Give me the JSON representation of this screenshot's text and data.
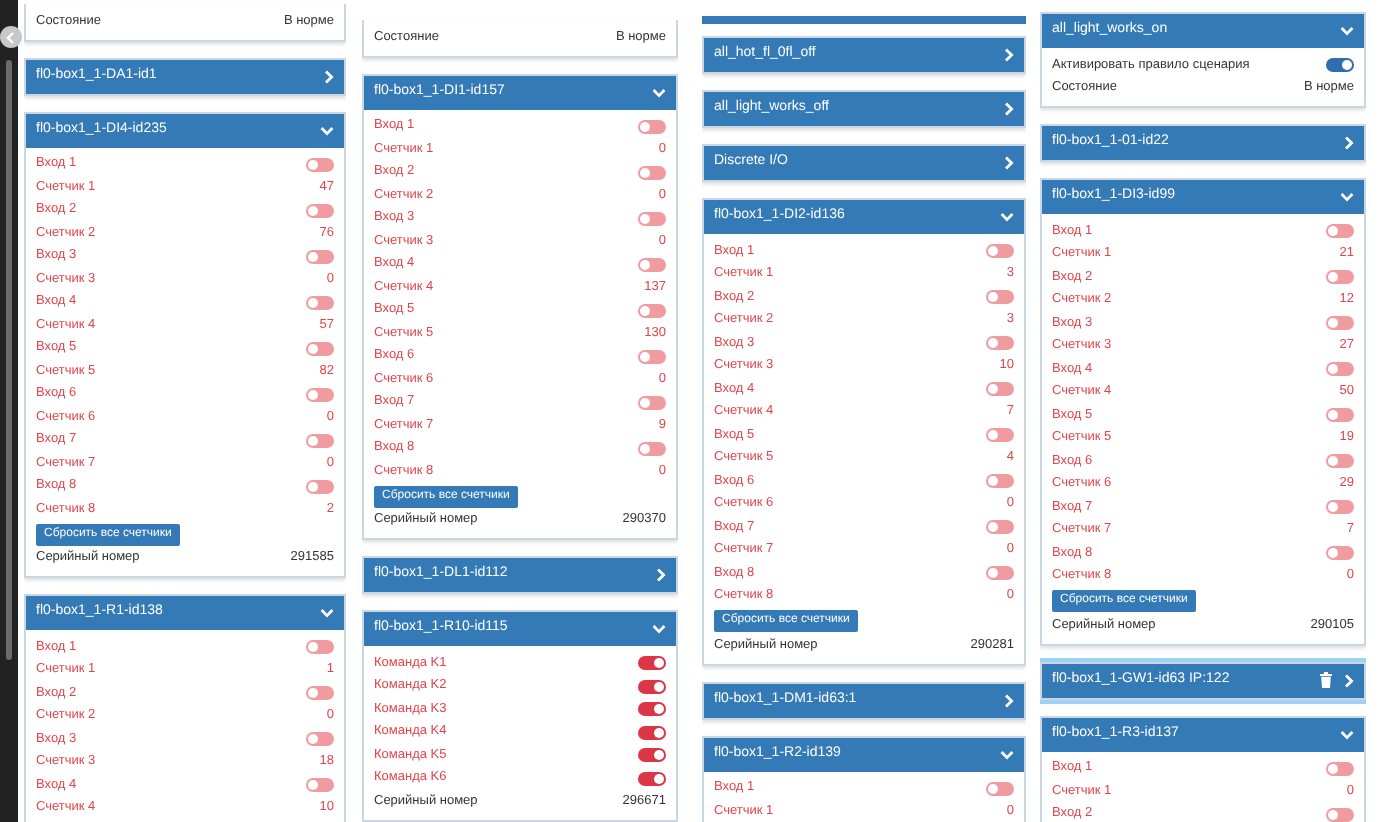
{
  "columns": [
    {
      "items": [
        {
          "kind": "card",
          "rows": [
            {
              "kind": "value",
              "label": "Состояние",
              "value": "В норме",
              "alert": false
            }
          ]
        },
        {
          "kind": "card",
          "title": "fl0-box1_1-DA1-id1",
          "expanded": false,
          "selected": false,
          "deletable": false
        },
        {
          "kind": "card",
          "title": "fl0-box1_1-DI4-id235",
          "expanded": true,
          "selected": false,
          "deletable": false,
          "rows": [
            {
              "kind": "toggle",
              "label": "Вход 1",
              "on": false,
              "alert": true
            },
            {
              "kind": "value",
              "label": "Счетчик 1",
              "value": "47",
              "alert": true
            },
            {
              "kind": "toggle",
              "label": "Вход 2",
              "on": false,
              "alert": true
            },
            {
              "kind": "value",
              "label": "Счетчик 2",
              "value": "76",
              "alert": true
            },
            {
              "kind": "toggle",
              "label": "Вход 3",
              "on": false,
              "alert": true
            },
            {
              "kind": "value",
              "label": "Счетчик 3",
              "value": "0",
              "alert": true
            },
            {
              "kind": "toggle",
              "label": "Вход 4",
              "on": false,
              "alert": true
            },
            {
              "kind": "value",
              "label": "Счетчик 4",
              "value": "57",
              "alert": true
            },
            {
              "kind": "toggle",
              "label": "Вход 5",
              "on": false,
              "alert": true
            },
            {
              "kind": "value",
              "label": "Счетчик 5",
              "value": "82",
              "alert": true
            },
            {
              "kind": "toggle",
              "label": "Вход 6",
              "on": false,
              "alert": true
            },
            {
              "kind": "value",
              "label": "Счетчик 6",
              "value": "0",
              "alert": true
            },
            {
              "kind": "toggle",
              "label": "Вход 7",
              "on": false,
              "alert": true
            },
            {
              "kind": "value",
              "label": "Счетчик 7",
              "value": "0",
              "alert": true
            },
            {
              "kind": "toggle",
              "label": "Вход 8",
              "on": false,
              "alert": true
            },
            {
              "kind": "value",
              "label": "Счетчик 8",
              "value": "2",
              "alert": true
            },
            {
              "kind": "button",
              "label": "Сбросить все счетчики"
            },
            {
              "kind": "value",
              "label": "Серийный номер",
              "value": "291585",
              "alert": false
            }
          ]
        },
        {
          "kind": "card",
          "title": "fl0-box1_1-R1-id138",
          "expanded": true,
          "selected": false,
          "deletable": false,
          "rows": [
            {
              "kind": "toggle",
              "label": "Вход 1",
              "on": false,
              "alert": true
            },
            {
              "kind": "value",
              "label": "Счетчик 1",
              "value": "1",
              "alert": true
            },
            {
              "kind": "toggle",
              "label": "Вход 2",
              "on": false,
              "alert": true
            },
            {
              "kind": "value",
              "label": "Счетчик 2",
              "value": "0",
              "alert": true
            },
            {
              "kind": "toggle",
              "label": "Вход 3",
              "on": false,
              "alert": true
            },
            {
              "kind": "value",
              "label": "Счетчик 3",
              "value": "18",
              "alert": true
            },
            {
              "kind": "toggle",
              "label": "Вход 4",
              "on": false,
              "alert": true
            },
            {
              "kind": "value",
              "label": "Счетчик 4",
              "value": "10",
              "alert": true
            }
          ]
        }
      ]
    },
    {
      "items": [
        {
          "kind": "card",
          "rows": [
            {
              "kind": "value",
              "label": "Состояние",
              "value": "В норме",
              "alert": false
            }
          ]
        },
        {
          "kind": "card",
          "title": "fl0-box1_1-DI1-id157",
          "expanded": true,
          "selected": false,
          "deletable": false,
          "rows": [
            {
              "kind": "toggle",
              "label": "Вход 1",
              "on": false,
              "alert": true
            },
            {
              "kind": "value",
              "label": "Счетчик 1",
              "value": "0",
              "alert": true
            },
            {
              "kind": "toggle",
              "label": "Вход 2",
              "on": false,
              "alert": true
            },
            {
              "kind": "value",
              "label": "Счетчик 2",
              "value": "0",
              "alert": true
            },
            {
              "kind": "toggle",
              "label": "Вход 3",
              "on": false,
              "alert": true
            },
            {
              "kind": "value",
              "label": "Счетчик 3",
              "value": "0",
              "alert": true
            },
            {
              "kind": "toggle",
              "label": "Вход 4",
              "on": false,
              "alert": true
            },
            {
              "kind": "value",
              "label": "Счетчик 4",
              "value": "137",
              "alert": true
            },
            {
              "kind": "toggle",
              "label": "Вход 5",
              "on": false,
              "alert": true
            },
            {
              "kind": "value",
              "label": "Счетчик 5",
              "value": "130",
              "alert": true
            },
            {
              "kind": "toggle",
              "label": "Вход 6",
              "on": false,
              "alert": true
            },
            {
              "kind": "value",
              "label": "Счетчик 6",
              "value": "0",
              "alert": true
            },
            {
              "kind": "toggle",
              "label": "Вход 7",
              "on": false,
              "alert": true
            },
            {
              "kind": "value",
              "label": "Счетчик 7",
              "value": "9",
              "alert": true
            },
            {
              "kind": "toggle",
              "label": "Вход 8",
              "on": false,
              "alert": true
            },
            {
              "kind": "value",
              "label": "Счетчик 8",
              "value": "0",
              "alert": true
            },
            {
              "kind": "button",
              "label": "Сбросить все счетчики"
            },
            {
              "kind": "value",
              "label": "Серийный номер",
              "value": "290370",
              "alert": false
            }
          ]
        },
        {
          "kind": "card",
          "title": "fl0-box1_1-DL1-id112",
          "expanded": false,
          "selected": false,
          "deletable": false
        },
        {
          "kind": "card",
          "title": "fl0-box1_1-R10-id115",
          "expanded": true,
          "selected": false,
          "deletable": false,
          "rows": [
            {
              "kind": "toggle",
              "label": "Команда K1",
              "on": true,
              "alert": true
            },
            {
              "kind": "toggle",
              "label": "Команда K2",
              "on": true,
              "alert": true
            },
            {
              "kind": "toggle",
              "label": "Команда K3",
              "on": true,
              "alert": true
            },
            {
              "kind": "toggle",
              "label": "Команда K4",
              "on": true,
              "alert": true
            },
            {
              "kind": "toggle",
              "label": "Команда K5",
              "on": true,
              "alert": true
            },
            {
              "kind": "toggle",
              "label": "Команда K6",
              "on": true,
              "alert": true
            },
            {
              "kind": "value",
              "label": "Серийный номер",
              "value": "296671",
              "alert": false
            }
          ]
        }
      ]
    },
    {
      "items": [
        {
          "kind": "header_fragment"
        },
        {
          "kind": "card",
          "title": "all_hot_fl_0fl_off",
          "expanded": false,
          "selected": false,
          "deletable": false
        },
        {
          "kind": "card",
          "title": "all_light_works_off",
          "expanded": false,
          "selected": false,
          "deletable": false
        },
        {
          "kind": "card",
          "title": "Discrete I/O",
          "expanded": false,
          "selected": false,
          "deletable": false
        },
        {
          "kind": "card",
          "title": "fl0-box1_1-DI2-id136",
          "expanded": true,
          "selected": false,
          "deletable": false,
          "rows": [
            {
              "kind": "toggle",
              "label": "Вход 1",
              "on": false,
              "alert": true
            },
            {
              "kind": "value",
              "label": "Счетчик 1",
              "value": "3",
              "alert": true
            },
            {
              "kind": "toggle",
              "label": "Вход 2",
              "on": false,
              "alert": true
            },
            {
              "kind": "value",
              "label": "Счетчик 2",
              "value": "3",
              "alert": true
            },
            {
              "kind": "toggle",
              "label": "Вход 3",
              "on": false,
              "alert": true
            },
            {
              "kind": "value",
              "label": "Счетчик 3",
              "value": "10",
              "alert": true
            },
            {
              "kind": "toggle",
              "label": "Вход 4",
              "on": false,
              "alert": true
            },
            {
              "kind": "value",
              "label": "Счетчик 4",
              "value": "7",
              "alert": true
            },
            {
              "kind": "toggle",
              "label": "Вход 5",
              "on": false,
              "alert": true
            },
            {
              "kind": "value",
              "label": "Счетчик 5",
              "value": "4",
              "alert": true
            },
            {
              "kind": "toggle",
              "label": "Вход 6",
              "on": false,
              "alert": true
            },
            {
              "kind": "value",
              "label": "Счетчик 6",
              "value": "0",
              "alert": true
            },
            {
              "kind": "toggle",
              "label": "Вход 7",
              "on": false,
              "alert": true
            },
            {
              "kind": "value",
              "label": "Счетчик 7",
              "value": "0",
              "alert": true
            },
            {
              "kind": "toggle",
              "label": "Вход 8",
              "on": false,
              "alert": true
            },
            {
              "kind": "value",
              "label": "Счетчик 8",
              "value": "0",
              "alert": true
            },
            {
              "kind": "button",
              "label": "Сбросить все счетчики"
            },
            {
              "kind": "value",
              "label": "Серийный номер",
              "value": "290281",
              "alert": false
            }
          ]
        },
        {
          "kind": "card",
          "title": "fl0-box1_1-DM1-id63:1",
          "expanded": false,
          "selected": false,
          "deletable": false
        },
        {
          "kind": "card",
          "title": "fl0-box1_1-R2-id139",
          "expanded": true,
          "selected": false,
          "deletable": false,
          "rows": [
            {
              "kind": "toggle",
              "label": "Вход 1",
              "on": false,
              "alert": true
            },
            {
              "kind": "value",
              "label": "Счетчик 1",
              "value": "0",
              "alert": true
            }
          ]
        }
      ]
    },
    {
      "items": [
        {
          "kind": "card",
          "title": "all_light_works_on",
          "expanded": true,
          "selected": false,
          "deletable": false,
          "rows": [
            {
              "kind": "toggle",
              "label": "Активировать правило сценария",
              "on": true,
              "alert": false
            },
            {
              "kind": "value",
              "label": "Состояние",
              "value": "В норме",
              "alert": false
            }
          ]
        },
        {
          "kind": "card",
          "title": "fl0-box1_1-01-id22",
          "expanded": false,
          "selected": false,
          "deletable": false
        },
        {
          "kind": "card",
          "title": "fl0-box1_1-DI3-id99",
          "expanded": true,
          "selected": false,
          "deletable": false,
          "rows": [
            {
              "kind": "toggle",
              "label": "Вход 1",
              "on": false,
              "alert": true
            },
            {
              "kind": "value",
              "label": "Счетчик 1",
              "value": "21",
              "alert": true
            },
            {
              "kind": "toggle",
              "label": "Вход 2",
              "on": false,
              "alert": true
            },
            {
              "kind": "value",
              "label": "Счетчик 2",
              "value": "12",
              "alert": true
            },
            {
              "kind": "toggle",
              "label": "Вход 3",
              "on": false,
              "alert": true
            },
            {
              "kind": "value",
              "label": "Счетчик 3",
              "value": "27",
              "alert": true
            },
            {
              "kind": "toggle",
              "label": "Вход 4",
              "on": false,
              "alert": true
            },
            {
              "kind": "value",
              "label": "Счетчик 4",
              "value": "50",
              "alert": true
            },
            {
              "kind": "toggle",
              "label": "Вход 5",
              "on": false,
              "alert": true
            },
            {
              "kind": "value",
              "label": "Счетчик 5",
              "value": "19",
              "alert": true
            },
            {
              "kind": "toggle",
              "label": "Вход 6",
              "on": false,
              "alert": true
            },
            {
              "kind": "value",
              "label": "Счетчик 6",
              "value": "29",
              "alert": true
            },
            {
              "kind": "toggle",
              "label": "Вход 7",
              "on": false,
              "alert": true
            },
            {
              "kind": "value",
              "label": "Счетчик 7",
              "value": "7",
              "alert": true
            },
            {
              "kind": "toggle",
              "label": "Вход 8",
              "on": false,
              "alert": true
            },
            {
              "kind": "value",
              "label": "Счетчик 8",
              "value": "0",
              "alert": true
            },
            {
              "kind": "button",
              "label": "Сбросить все счетчики"
            },
            {
              "kind": "value",
              "label": "Серийный номер",
              "value": "290105",
              "alert": false
            }
          ]
        },
        {
          "kind": "card",
          "title": "fl0-box1_1-GW1-id63 IP:122",
          "expanded": false,
          "selected": true,
          "deletable": true
        },
        {
          "kind": "card",
          "title": "fl0-box1_1-R3-id137",
          "expanded": true,
          "selected": false,
          "deletable": false,
          "rows": [
            {
              "kind": "toggle",
              "label": "Вход 1",
              "on": false,
              "alert": true
            },
            {
              "kind": "value",
              "label": "Счетчик 1",
              "value": "0",
              "alert": true
            },
            {
              "kind": "toggle",
              "label": "Вход 2",
              "on": false,
              "alert": true
            }
          ]
        }
      ]
    }
  ]
}
